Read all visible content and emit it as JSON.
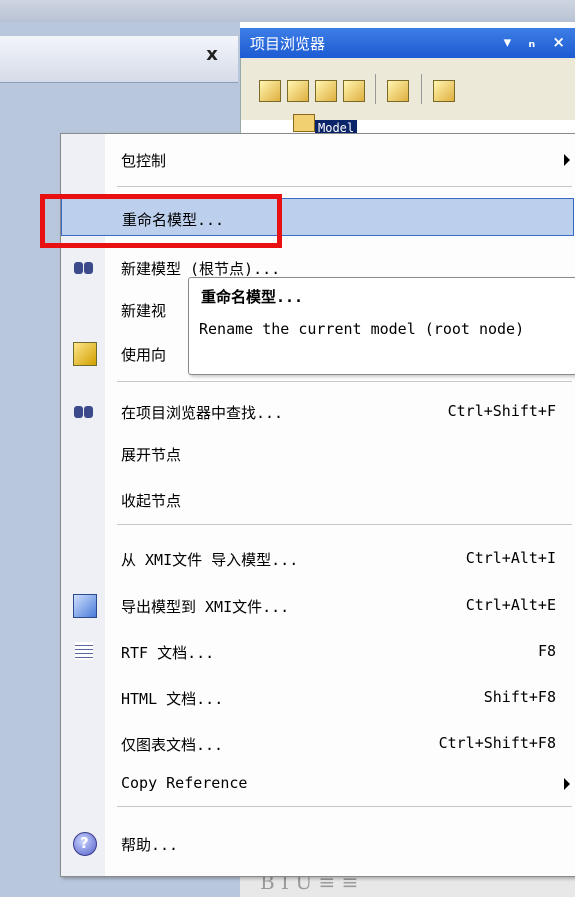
{
  "left_panel": {
    "close_glyph": "x"
  },
  "project_browser": {
    "title": "项目浏览器",
    "pin_glyph": "ₙ",
    "close_glyph": "×",
    "dropdown_glyph": "▾",
    "tree": {
      "root_label": "Model"
    },
    "format_bar": "B I U ≡ ≡"
  },
  "menu": {
    "items": [
      {
        "label": "包控制",
        "shortcut": "",
        "submenu": true
      },
      {
        "label": "重命名模型...",
        "shortcut": "",
        "highlighted": true
      },
      {
        "label": "新建模型 (根节点)...",
        "shortcut": ""
      },
      {
        "label": "新建视",
        "shortcut": ""
      },
      {
        "label": "使用向",
        "shortcut": ""
      },
      {
        "label": "在项目浏览器中查找...",
        "shortcut": "Ctrl+Shift+F"
      },
      {
        "label": "展开节点",
        "shortcut": ""
      },
      {
        "label": "收起节点",
        "shortcut": ""
      },
      {
        "label": "从 XMI文件 导入模型...",
        "shortcut": "Ctrl+Alt+I"
      },
      {
        "label": "导出模型到 XMI文件...",
        "shortcut": "Ctrl+Alt+E"
      },
      {
        "label": "RTF  文档...",
        "shortcut": "F8"
      },
      {
        "label": "HTML 文档...",
        "shortcut": "Shift+F8"
      },
      {
        "label": "仅图表文档...",
        "shortcut": "Ctrl+Shift+F8"
      },
      {
        "label": "Copy Reference",
        "shortcut": "",
        "submenu": true
      },
      {
        "label": "帮助...",
        "shortcut": ""
      }
    ]
  },
  "tooltip": {
    "title": "重命名模型...",
    "description": "Rename the current model (root node)"
  },
  "colors": {
    "highlight": "#bcd0ee",
    "annotation_box": "#e81010",
    "title_bar": "#2a66da"
  }
}
